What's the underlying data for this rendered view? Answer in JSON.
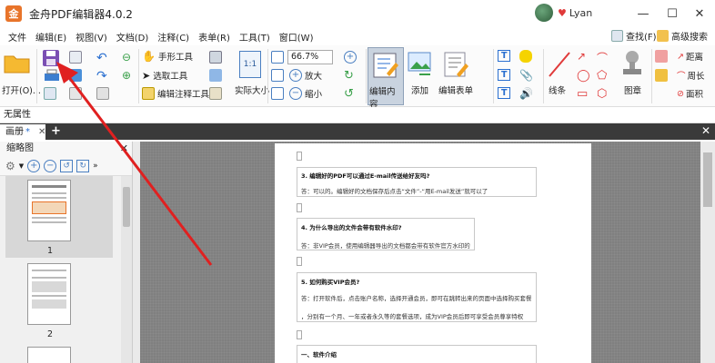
{
  "app": {
    "title": "金舟PDF编辑器4.0.2",
    "logo_letter": "金",
    "user_name": "Lyan"
  },
  "window_controls": {
    "minimize": "—",
    "maximize": "☐",
    "close": "✕"
  },
  "menu": {
    "items": [
      "文件",
      "编辑(E)",
      "视图(V)",
      "文档(D)",
      "注释(C)",
      "表单(R)",
      "工具(T)",
      "窗口(W)"
    ],
    "find": "查找(F)",
    "advanced_search": "高级搜索"
  },
  "ribbon": {
    "open_label": "打开(O)...",
    "hand_tool": "手形工具",
    "select_tool": "选取工具",
    "edit_annot_tool": "编辑注释工具",
    "actual_size": "实际大小",
    "actual_size_icon": "1:1",
    "zoom_value": "66.7%",
    "zoom_in": "放大",
    "zoom_out": "缩小",
    "edit_content": "编辑内容",
    "add": "添加",
    "edit_form": "编辑表单",
    "lines": "线条",
    "stamp": "图章",
    "distance": "距离",
    "perimeter": "周长",
    "area": "面积"
  },
  "properties": {
    "label": "无属性"
  },
  "tabs": {
    "doc_tab": "画册",
    "modified_mark": "*"
  },
  "thumbnails": {
    "header": "缩略图",
    "pages": [
      "1",
      "2"
    ]
  },
  "document": {
    "blocks": [
      {
        "q": "3. 编辑好的PDF可以通过E-mail传送给好友吗?",
        "a": [
          "答：可以的。编辑好的文档保存后点击“文件”-“用E-mail发送”就可以了"
        ]
      },
      {
        "q": "4. 为什么导出的文件会带有软件水印?",
        "a": [
          "答：非VIP会员，使用编辑器导出的文档都会带有软件官方水印的"
        ]
      },
      {
        "q": "5. 如何购买VIP会员?",
        "a": [
          "答：打开软件后，点击账户名称，选择开通会员，即可在跳转出来的页面中选择购买套餐",
          "，分别有一个月、一年或者永久等的套餐选项，成为VIP会员后即可享受会员尊享特权"
        ]
      },
      {
        "q": "一、软件介绍",
        "a": []
      }
    ]
  },
  "colors": {
    "accent_arrow": "#e02020",
    "tab_bar": "#3a3a3a",
    "workspace": "#808080"
  }
}
